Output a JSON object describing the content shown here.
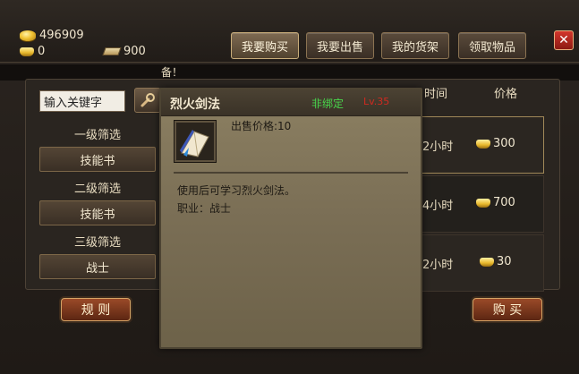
{
  "currency": {
    "coins": "496909",
    "gold": "0",
    "tickets": "900"
  },
  "tabs": [
    {
      "label": "我要购买",
      "active": true
    },
    {
      "label": "我要出售",
      "active": false
    },
    {
      "label": "我的货架",
      "active": false
    },
    {
      "label": "领取物品",
      "active": false
    }
  ],
  "close_label": "✕",
  "notice_text": "备！",
  "search": {
    "value": "输入关键字",
    "icon": "magnifier-icon"
  },
  "filters": [
    {
      "label": "一级筛选",
      "value": "技能书"
    },
    {
      "label": "二级筛选",
      "value": "技能书"
    },
    {
      "label": "三级筛选",
      "value": "战士"
    }
  ],
  "columns": {
    "time": "时间",
    "price": "价格"
  },
  "rows": [
    {
      "time": "2小时",
      "price": "300"
    },
    {
      "time": "4小时",
      "price": "700"
    },
    {
      "time": "2小时",
      "price": "30"
    }
  ],
  "buttons": {
    "rules": "规 则",
    "buy": "购 买"
  },
  "tooltip": {
    "name": "烈火剑法",
    "bind_status": "非绑定",
    "flag": "Lv.35",
    "price_label": "出售价格:10",
    "description": "使用后可学习烈火剑法。",
    "job": "职业：战士",
    "item_icon": "skill-book-icon"
  },
  "colors": {
    "bind_green": "#48d84c",
    "accent_red": "#d02a20",
    "gold": "#f0c232"
  }
}
